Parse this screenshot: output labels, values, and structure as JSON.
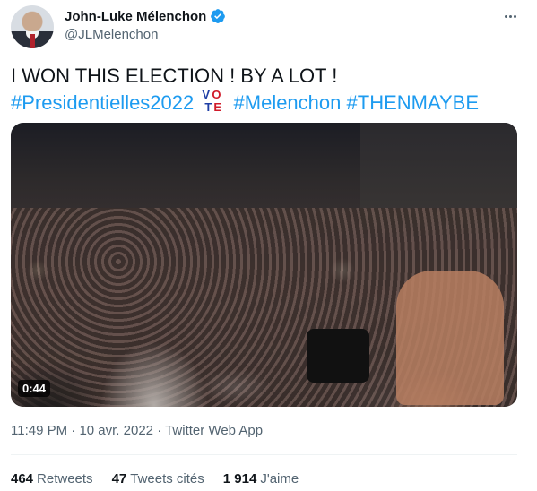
{
  "author": {
    "display_name": "John-Luke Mélenchon",
    "handle": "@JLMelenchon",
    "verified": true,
    "verified_color": "#1d9bf0"
  },
  "tweet": {
    "text_plain": "I WON THIS ELECTION ! BY A LOT !",
    "hashtags": [
      "#Presidentielles2022",
      "#Melenchon",
      "#THENMAYBE"
    ],
    "emoji": {
      "name": "vote-emoji",
      "letters": [
        "V",
        "O",
        "T",
        "E"
      ],
      "colors": [
        "#1f3fa5",
        "#d01b2a",
        "#1f3fa5",
        "#d01b2a"
      ]
    },
    "link_color": "#1d9bf0"
  },
  "media": {
    "type": "video",
    "duration": "0:44"
  },
  "meta": {
    "time": "11:49 PM",
    "separator": "·",
    "date": "10 avr. 2022",
    "app": "Twitter Web App"
  },
  "stats": {
    "retweets": {
      "count": "464",
      "label": "Retweets"
    },
    "quotes": {
      "count": "47",
      "label": "Tweets cités"
    },
    "likes": {
      "count": "1 914",
      "label": "J'aime"
    }
  }
}
